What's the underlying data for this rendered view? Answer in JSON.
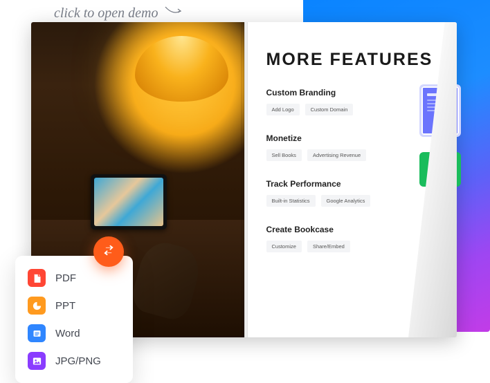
{
  "hint": {
    "text": "click to open demo"
  },
  "page_right": {
    "title": "MORE FEATURES",
    "sections": [
      {
        "heading": "Custom Branding",
        "chips": [
          "Add Logo",
          "Custom Domain"
        ]
      },
      {
        "heading": "Monetize",
        "chips": [
          "Sell Books",
          "Advertising Revenue"
        ]
      },
      {
        "heading": "Track Performance",
        "chips": [
          "Built-in Statistics",
          "Google Analytics"
        ]
      },
      {
        "heading": "Create Bookcase",
        "chips": [
          "Customize",
          "Share/Embed"
        ]
      }
    ]
  },
  "fab": {
    "icon_name": "swap-icon"
  },
  "formats": {
    "items": [
      {
        "label": "PDF",
        "color": "#ff4634",
        "kind": "pdf"
      },
      {
        "label": "PPT",
        "color": "#ff9a1f",
        "kind": "ppt"
      },
      {
        "label": "Word",
        "color": "#2f86ff",
        "kind": "word"
      },
      {
        "label": "JPG/PNG",
        "color": "#8a3cff",
        "kind": "image"
      }
    ]
  }
}
